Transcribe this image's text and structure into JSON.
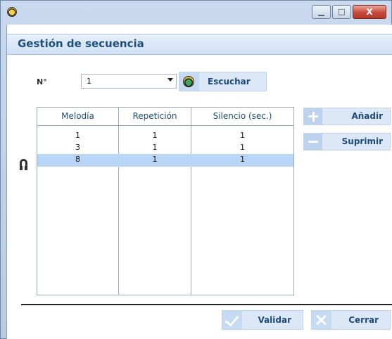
{
  "window": {
    "title": "",
    "minimize_glyph": "▁",
    "maximize_glyph": "□",
    "close_glyph": "X"
  },
  "header": {
    "title": "Gestión de secuencia"
  },
  "number_field": {
    "label": "N°",
    "value": "1"
  },
  "listen_button": {
    "label": "Escuchar",
    "icon": "headphones-icon"
  },
  "side_buttons": {
    "add_label": "Añadir",
    "delete_label": "Suprimir"
  },
  "table": {
    "columns": [
      "Melodía",
      "Repetición",
      "Silencio (sec.)"
    ],
    "rows": [
      [
        "1",
        "1",
        "1"
      ],
      [
        "3",
        "1",
        "1"
      ],
      [
        "8",
        "1",
        "1"
      ]
    ],
    "selected_row": 2
  },
  "footer": {
    "ok_label": "Validar",
    "cancel_label": "Cerrar"
  },
  "colors": {
    "accent": "#1f4e79",
    "selection": "#b9d5f5",
    "button_bg": "#dce8f7"
  }
}
